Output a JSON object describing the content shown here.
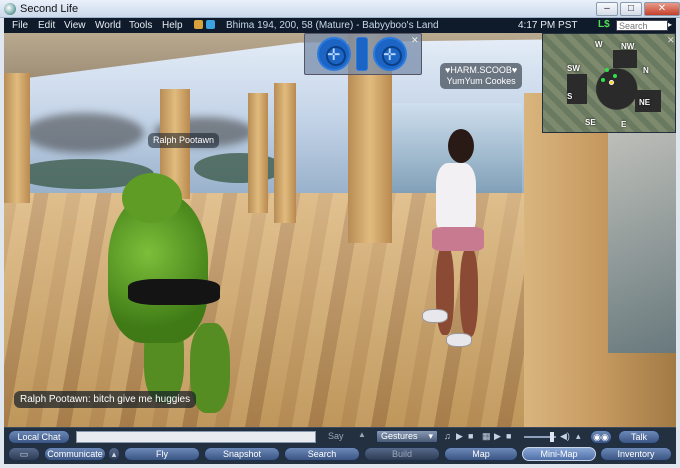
{
  "window": {
    "title": "Second Life",
    "controls": [
      "–",
      "□",
      "✕"
    ]
  },
  "menu": {
    "items": [
      "File",
      "Edit",
      "View",
      "World",
      "Tools",
      "Help"
    ]
  },
  "status": {
    "location": "Bhima 194, 200, 58 (Mature) - Babyyboo's Land",
    "time": "4:17 PM PST",
    "balance": "L$",
    "search_placeholder": "Search"
  },
  "scene": {
    "avatars": [
      {
        "name": "Ralph Pootawn"
      },
      {
        "name": "♥HARM.SCOOB♥",
        "subname": "YumYum Cookes"
      }
    ],
    "chat_bubble": "Ralph Pootawn: bitch give me huggies"
  },
  "minimap": {
    "labels": [
      "W",
      "NW",
      "N",
      "NE",
      "SW",
      "S",
      "SE",
      "E"
    ]
  },
  "chatbar": {
    "local_chat": "Local Chat",
    "say": "Say",
    "gestures": "Gestures"
  },
  "toolbar": {
    "buttons": [
      "Communicate",
      "Fly",
      "Snapshot",
      "Search",
      "Build",
      "Map",
      "Mini-Map",
      "Inventory"
    ],
    "talk": "Talk"
  },
  "colors": {
    "menubar_bg": "#0f1b2a",
    "balance_green": "#4ee04e",
    "button_blue": "#3a5583"
  }
}
